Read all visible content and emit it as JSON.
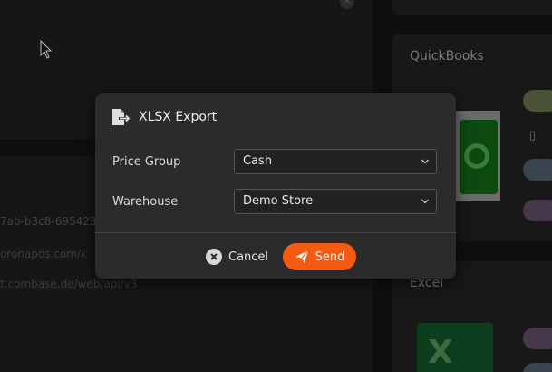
{
  "background": {
    "qb_card_title": "QuickBooks",
    "excel_card_title": "Excel",
    "text_line_1": "7ab-b3c8-695423",
    "text_line_2": "oronapos.com/k",
    "text_line_3": "t.combase.de/web/api/v3"
  },
  "modal": {
    "title": "XLSX Export",
    "icon": "file-export-icon",
    "fields": [
      {
        "label": "Price Group",
        "value": "Cash"
      },
      {
        "label": "Warehouse",
        "value": "Demo Store"
      }
    ],
    "cancel_label": "Cancel",
    "send_label": "Send"
  },
  "colors": {
    "accent": "#f45a12",
    "modal_bg": "#2b2b2b",
    "page_bg": "#141414"
  }
}
